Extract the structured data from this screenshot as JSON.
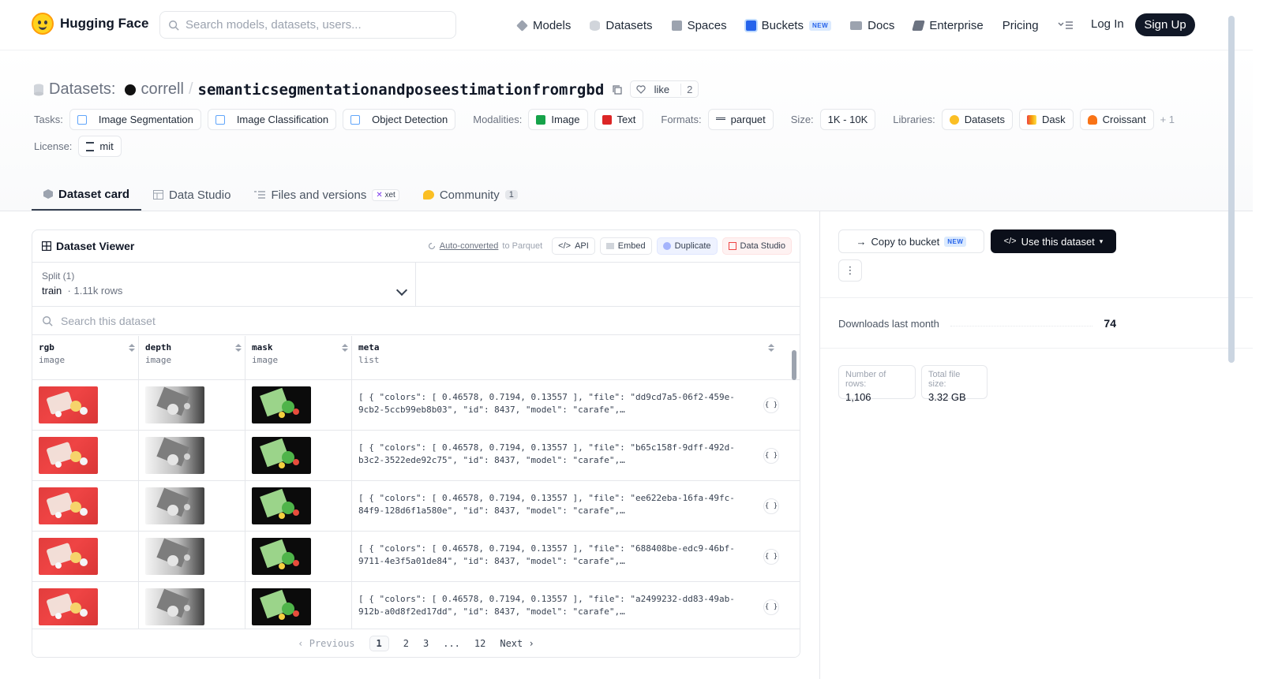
{
  "header": {
    "brand": "Hugging Face",
    "search_placeholder": "Search models, datasets, users...",
    "nav": [
      {
        "label": "Models",
        "color": "#9ca3af"
      },
      {
        "label": "Datasets",
        "color": "#d1d5db"
      },
      {
        "label": "Spaces",
        "color": "#9ca3af"
      },
      {
        "label": "Buckets",
        "color": "#2563eb",
        "badge": "NEW"
      },
      {
        "label": "Docs",
        "color": "#9ca3af"
      },
      {
        "label": "Enterprise",
        "color": "#6b7280"
      },
      {
        "label": "Pricing"
      }
    ],
    "login": "Log In",
    "signup": "Sign Up"
  },
  "repo": {
    "prefix": "Datasets:",
    "owner": "correll",
    "separator": "/",
    "name": "semanticsegmentationandposeestimationfromrgbd",
    "like_label": "like",
    "like_count": "2"
  },
  "tags": {
    "tasks_label": "Tasks:",
    "tasks": [
      "Image Segmentation",
      "Image Classification",
      "Object Detection"
    ],
    "modalities_label": "Modalities:",
    "modalities": [
      "Image",
      "Text"
    ],
    "formats_label": "Formats:",
    "formats": [
      "parquet"
    ],
    "size_label": "Size:",
    "size": "1K - 10K",
    "libraries_label": "Libraries:",
    "libraries": [
      "Datasets",
      "Dask",
      "Croissant"
    ],
    "libraries_more": "+ 1",
    "license_label": "License:",
    "license": "mit"
  },
  "tabs": [
    {
      "label": "Dataset card",
      "active": true
    },
    {
      "label": "Data Studio"
    },
    {
      "label": "Files and versions",
      "badge": "xet"
    },
    {
      "label": "Community",
      "count": "1"
    }
  ],
  "viewer": {
    "title": "Dataset Viewer",
    "auto_converted": "Auto-converted",
    "to_parquet": "to Parquet",
    "api": "API",
    "embed": "Embed",
    "duplicate": "Duplicate",
    "data_studio": "Data Studio",
    "split_label": "Split (1)",
    "split_value": "train",
    "split_rows": "1.11k rows",
    "search_placeholder": "Search this dataset",
    "columns": [
      {
        "name": "rgb",
        "type": "image"
      },
      {
        "name": "depth",
        "type": "image"
      },
      {
        "name": "mask",
        "type": "image"
      },
      {
        "name": "meta",
        "type": "list"
      }
    ],
    "rows": [
      {
        "meta": "[ { \"colors\": [ 0.46578, 0.7194, 0.13557 ], \"file\": \"dd9cd7a5-06f2-459e-9cb2-5ccb99eb8b03\", \"id\": 8437, \"model\": \"carafe\",…"
      },
      {
        "meta": "[ { \"colors\": [ 0.46578, 0.7194, 0.13557 ], \"file\": \"b65c158f-9dff-492d-b3c2-3522ede92c75\", \"id\": 8437, \"model\": \"carafe\",…"
      },
      {
        "meta": "[ { \"colors\": [ 0.46578, 0.7194, 0.13557 ], \"file\": \"ee622eba-16fa-49fc-84f9-128d6f1a580e\", \"id\": 8437, \"model\": \"carafe\",…"
      },
      {
        "meta": "[ { \"colors\": [ 0.46578, 0.7194, 0.13557 ], \"file\": \"688408be-edc9-46bf-9711-4e3f5a01de84\", \"id\": 8437, \"model\": \"carafe\",…"
      },
      {
        "meta": "[ { \"colors\": [ 0.46578, 0.7194, 0.13557 ], \"file\": \"a2499232-dd83-49ab-912b-a0d8f2ed17dd\", \"id\": 8437, \"model\": \"carafe\",…"
      }
    ],
    "json_icon": "{ }",
    "pager": {
      "previous": "Previous",
      "pages": [
        "1",
        "2",
        "3",
        "...",
        "12"
      ],
      "current": "1",
      "next": "Next"
    }
  },
  "sidebar": {
    "copy_bucket": "Copy to bucket",
    "copy_bucket_badge": "NEW",
    "use_dataset": "Use this dataset",
    "downloads_label": "Downloads last month",
    "downloads_value": "74",
    "rows_label": "Number of rows:",
    "rows_value": "1,106",
    "size_label": "Total file size:",
    "size_value": "3.32 GB"
  }
}
